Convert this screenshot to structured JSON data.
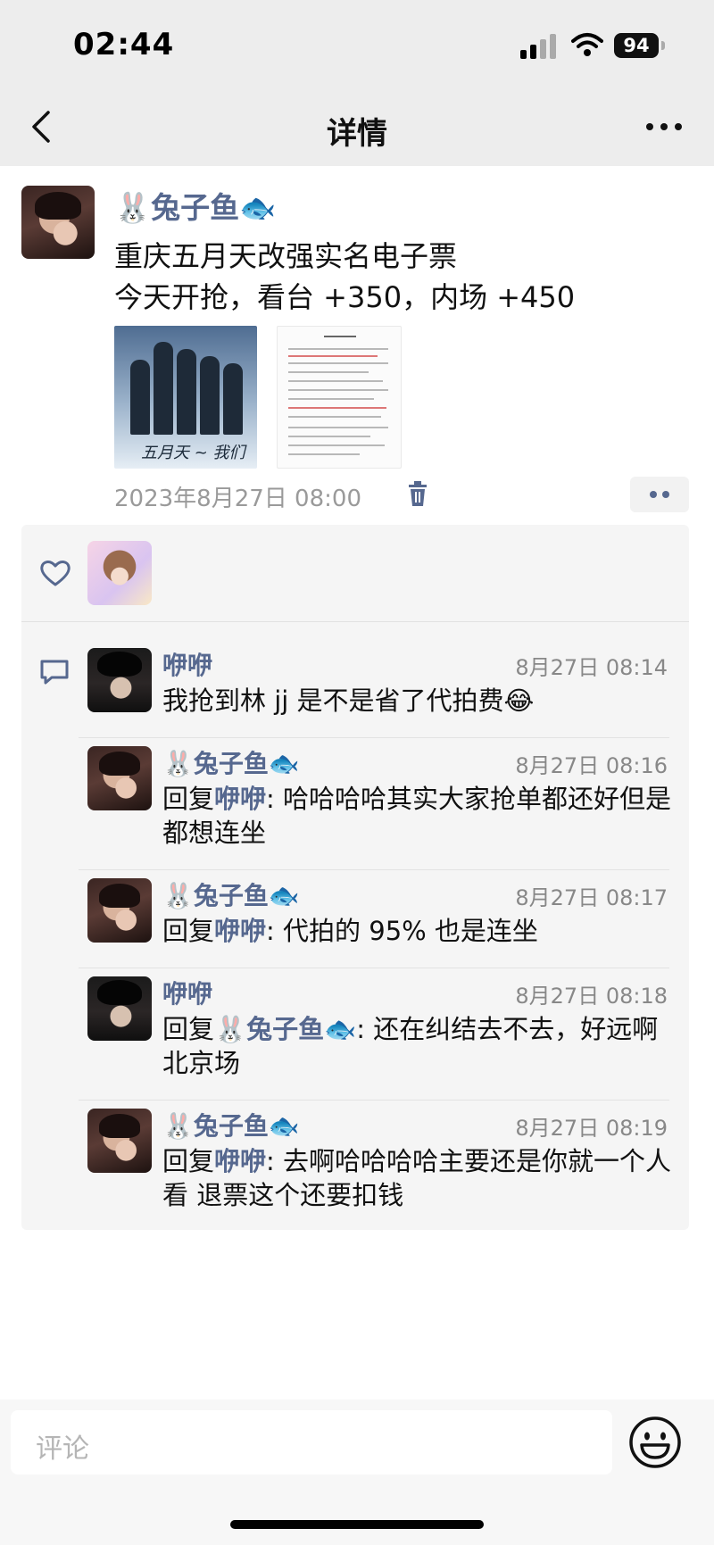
{
  "status_bar": {
    "time": "02:44",
    "battery": "94"
  },
  "nav": {
    "title": "详情"
  },
  "post": {
    "author": "🐰兔子鱼🐟",
    "lines": [
      "重庆五月天改强实名电子票",
      "今天开抢，看台 +350，内场 +450"
    ],
    "date": "2023年8月27日 08:00",
    "images": [
      "poster-image",
      "document-image"
    ]
  },
  "comments": [
    {
      "author": "咿咿",
      "time": "8月27日 08:14",
      "prefix": "",
      "reply_to": "",
      "sep": "",
      "text": "我抢到林 jj 是不是省了代拍费😂"
    },
    {
      "author": "🐰兔子鱼🐟",
      "time": "8月27日 08:16",
      "prefix": "回复",
      "reply_to": "咿咿",
      "sep": ": ",
      "text": "哈哈哈哈其实大家抢单都还好但是都想连坐"
    },
    {
      "author": "🐰兔子鱼🐟",
      "time": "8月27日 08:17",
      "prefix": "回复",
      "reply_to": "咿咿",
      "sep": ": ",
      "text": "代拍的 95% 也是连坐"
    },
    {
      "author": "咿咿",
      "time": "8月27日 08:18",
      "prefix": "回复",
      "reply_to": "🐰兔子鱼🐟",
      "sep": ": ",
      "text": "还在纠结去不去，好远啊北京场"
    },
    {
      "author": "🐰兔子鱼🐟",
      "time": "8月27日 08:19",
      "prefix": "回复",
      "reply_to": "咿咿",
      "sep": ": ",
      "text": "去啊哈哈哈哈主要还是你就一个人看 退票这个还要扣钱"
    }
  ],
  "input": {
    "placeholder": "评论"
  },
  "colors": {
    "link": "#56688f",
    "nav_bg": "#ededed",
    "panel_bg": "#f5f5f5"
  }
}
